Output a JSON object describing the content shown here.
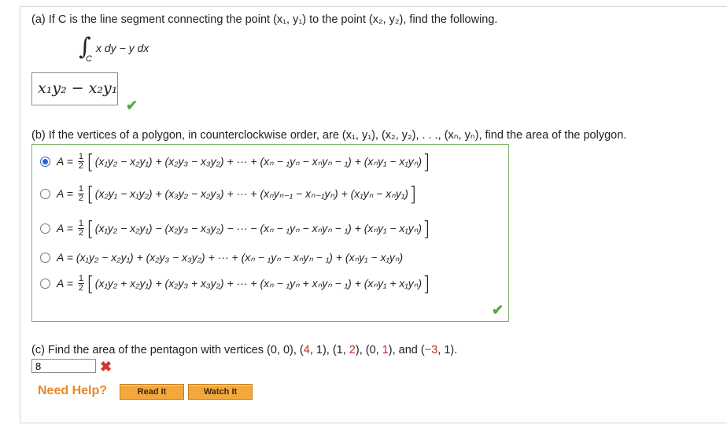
{
  "part_a": {
    "question": "(a) If C is the line segment connecting the point (x₁, y₁) to the point (x₂, y₂), find the following.",
    "integral_sub": "C",
    "integrand": "x dy − y dx",
    "answer": "x₁y₂ − x₂y₁",
    "status": "correct"
  },
  "part_b": {
    "question": "(b) If the vertices of a polygon, in counterclockwise order, are (x₁, y₁), (x₂, y₂), . . ., (xₙ, yₙ), find the area of the polygon.",
    "choices": [
      {
        "prefix": "A =",
        "fraction": [
          "1",
          "2"
        ],
        "body": "(x₁y₂ − x₂y₁) + (x₂y₃ − x₃y₂) + ··· + (xₙ − ₁yₙ − xₙyₙ − ₁) + (xₙy₁ − x₁yₙ)",
        "selected": true
      },
      {
        "prefix": "A =",
        "fraction": [
          "1",
          "2"
        ],
        "body": "(x₂y₁ − x₁y₂) + (x₃y₂ − x₂y₃) + ··· + (xₙyₙ₋₁ − xₙ₋₁yₙ) + (x₁yₙ − xₙy₁)",
        "selected": false
      },
      {
        "prefix": "A =",
        "fraction": [
          "1",
          "2"
        ],
        "body": "(x₁y₂ − x₂y₁) − (x₂y₃ − x₃y₂) − ··· − (xₙ − ₁yₙ − xₙyₙ − ₁) + (xₙy₁ − x₁yₙ)",
        "selected": false
      },
      {
        "prefix": "A =",
        "fraction": null,
        "body": "(x₁y₂ − x₂y₁) + (x₂y₃ − x₃y₂) + ··· + (xₙ − ₁yₙ − xₙyₙ − ₁) + (xₙy₁ − x₁yₙ)",
        "selected": false
      },
      {
        "prefix": "A =",
        "fraction": [
          "1",
          "2"
        ],
        "body": "(x₁y₂ + x₂y₁) + (x₂y₃ + x₃y₂) + ··· + (xₙ − ₁yₙ + xₙyₙ − ₁) + (xₙy₁ + x₁yₙ)",
        "selected": false
      }
    ],
    "status": "correct"
  },
  "part_c": {
    "q_start": "(c) Find the area of the pentagon with vertices (0, 0), (",
    "v1": "4",
    "q_mid1": ", 1), (1, ",
    "v2": "2",
    "q_mid2": "), (0, ",
    "v3": "1",
    "q_mid3": "), and (",
    "v4": "−3",
    "q_end": ", 1).",
    "input_value": "8",
    "status": "incorrect"
  },
  "help": {
    "label": "Need Help?",
    "read_it": "Read It",
    "watch_it": "Watch It"
  },
  "colors": {
    "correct": "#5aa54a",
    "incorrect": "#d9342b",
    "accent": "#f4a83b",
    "radio": "#2a66c9"
  }
}
